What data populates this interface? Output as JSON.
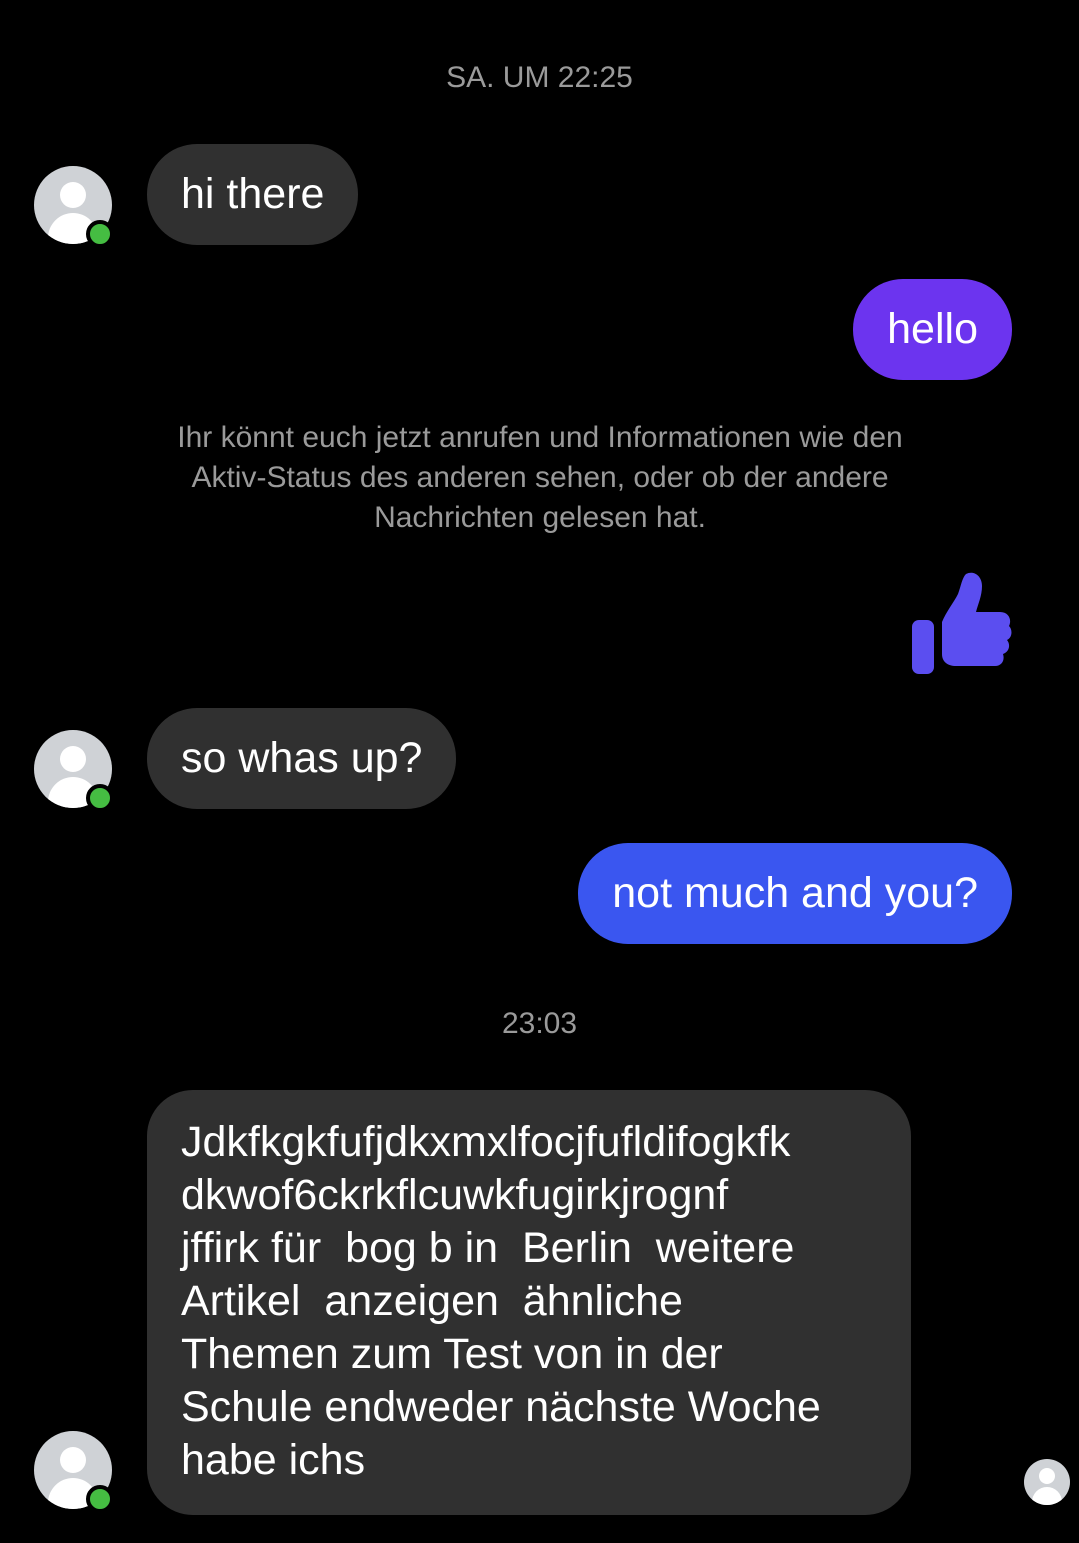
{
  "timestamps": {
    "first": "SA. UM 22:25",
    "second": "23:03"
  },
  "messages": [
    {
      "direction": "incoming",
      "text": "hi there"
    },
    {
      "direction": "outgoing",
      "text": "hello"
    },
    {
      "direction": "incoming",
      "text": "so whas up?"
    },
    {
      "direction": "outgoing",
      "text": "not much and you?"
    },
    {
      "direction": "incoming",
      "text": "Jdkfkgkfufjdkxmxlfocjfufldifogkfk\ndkwof6ckrkflcuwkfugirkjrognf\njffirk für  bog b in  Berlin  weitere\nArtikel  anzeigen  ähnliche\nThemen zum Test von in der\nSchule endweder nächste Woche\nhabe ichs"
    }
  ],
  "system_note": "Ihr könnt euch jetzt anrufen und Informationen wie den Aktiv-Status des anderen sehen, oder ob der andere Nachrichten gelesen hat.",
  "reaction": {
    "icon": "thumbs-up-icon",
    "color": "#5b4ef0"
  },
  "colors": {
    "background": "#000000",
    "incoming_bubble": "#303030",
    "outgoing_bubble_1": "#6c34ef",
    "outgoing_bubble_2": "#3a56f0",
    "online_indicator": "#45bd42",
    "muted_text": "#9a9a9a"
  }
}
